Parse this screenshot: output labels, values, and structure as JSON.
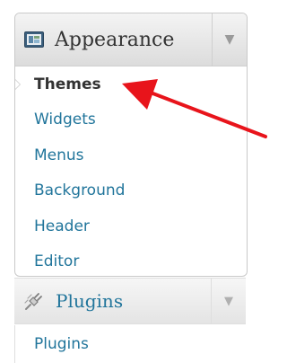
{
  "appearance": {
    "label": "Appearance",
    "toggle": "▼",
    "items": [
      {
        "label": "Themes",
        "current": true
      },
      {
        "label": "Widgets",
        "current": false
      },
      {
        "label": "Menus",
        "current": false
      },
      {
        "label": "Background",
        "current": false
      },
      {
        "label": "Header",
        "current": false
      },
      {
        "label": "Editor",
        "current": false
      }
    ]
  },
  "plugins": {
    "label": "Plugins",
    "toggle": "▼",
    "items": [
      {
        "label": "Plugins"
      }
    ]
  },
  "icons": {
    "appearance": "appearance-icon",
    "plugins": "plugin-icon",
    "annotation": "red-arrow"
  },
  "colors": {
    "link": "#21759b",
    "current_text": "#333333",
    "annotation": "#e8141b"
  }
}
